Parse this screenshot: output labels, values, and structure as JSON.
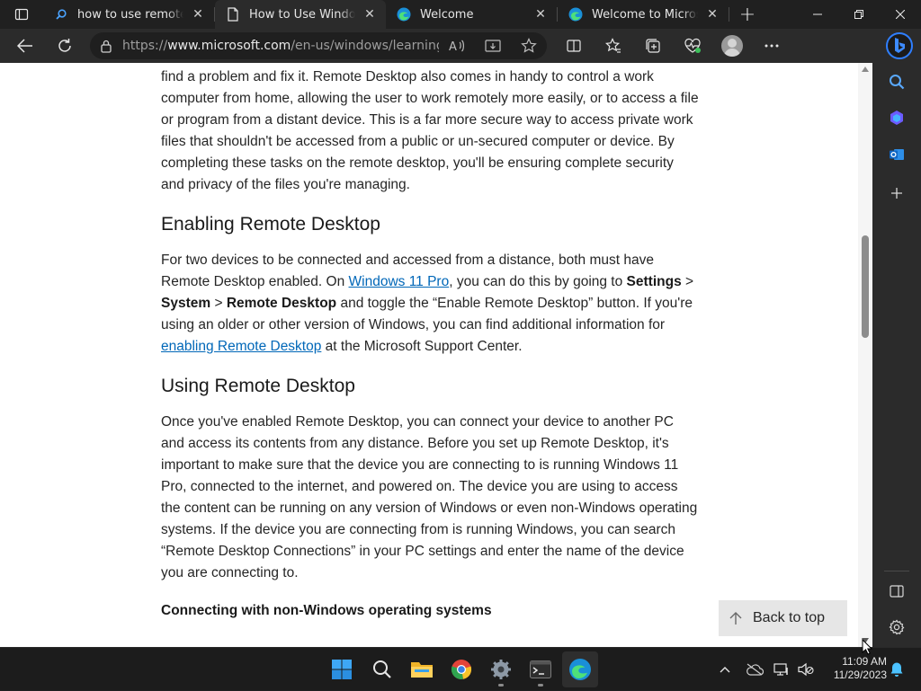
{
  "tabs": [
    {
      "title": "how to use remote desktop - Search",
      "active": false,
      "icon": "search-icon"
    },
    {
      "title": "How to Use Windows Remote Desktop",
      "active": true,
      "icon": "page-icon"
    },
    {
      "title": "Welcome",
      "active": false,
      "icon": "edge-icon"
    },
    {
      "title": "Welcome to Microsoft Edge",
      "active": false,
      "icon": "edge-icon"
    }
  ],
  "address": {
    "prefix": "https://",
    "domain": "www.microsoft.com",
    "path": "/en-us/windows/learning-center/use-wi..."
  },
  "article": {
    "p1": "gaining access to the device they're fixing, they can click through computer settings to find a problem and fix it. Remote Desktop also comes in handy to control a work computer from home, allowing the user to work remotely more easily, or to access a file or program from a distant device. This is a far more secure way to access private work files that shouldn't be accessed from a public or un-secured computer or device. By completing these tasks on the remote desktop, you'll be ensuring complete security and privacy of the files you're managing.",
    "h_enabling": "Enabling Remote Desktop",
    "p2_a": "For two devices to be connected and accessed from a distance, both must have Remote Desktop enabled. On ",
    "p2_link1": "Windows 11 Pro",
    "p2_b": ", you can do this by going to ",
    "p2_settings": "Settings",
    "p2_gt1": " > ",
    "p2_system": "System",
    "p2_gt2": " > ",
    "p2_rd": "Remote Desktop",
    "p2_c": " and toggle the “Enable Remote Desktop” button. If you're using an older or other version of Windows, you can find additional information for ",
    "p2_link2": "enabling Remote Desktop",
    "p2_d": " at the Microsoft Support Center.",
    "h_using": "Using Remote Desktop",
    "p3": "Once you've enabled Remote Desktop, you can connect your device to another PC and access its contents from any distance. Before you set up Remote Desktop, it's important to make sure that the device you are connecting to is running Windows 11 Pro, connected to the internet, and powered on. The device you are using to access the content can be running on any version of Windows or even non-Windows operating systems. If the device you are connecting from is running Windows, you can search “Remote Desktop Connections” in your PC settings and enter the name of the device you are connecting to.",
    "h_nonwin": "Connecting with non-Windows operating systems"
  },
  "back_to_top": "Back to top",
  "clock": {
    "time": "11:09 AM",
    "date": "11/29/2023"
  },
  "colors": {
    "link": "#0067b8",
    "accent": "#4cc2ff",
    "chrome": "#2b2b2b"
  }
}
